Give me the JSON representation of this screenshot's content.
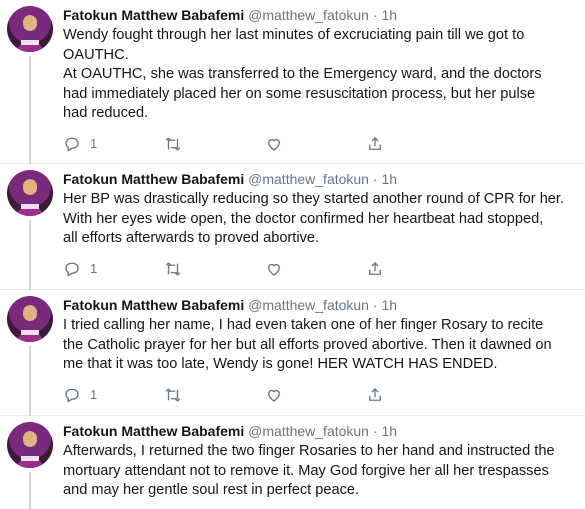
{
  "tweets": [
    {
      "name": "Fatokun Matthew Babafemi",
      "handle": "@matthew_fatokun",
      "separator": "·",
      "time": "1h",
      "lines": [
        "Wendy fought through her last minutes of excruciating pain till we got to",
        "OAUTHC.",
        "At OAUTHC, she was transferred to the Emergency ward, and the doctors",
        "had immediately placed her on some resuscitation process, but her pulse",
        "had reduced."
      ],
      "reply_count": "1"
    },
    {
      "name": "Fatokun Matthew Babafemi",
      "handle": "@matthew_fatokun",
      "separator": "·",
      "time": "1h",
      "lines": [
        "Her BP was drastically reducing so they started another round of CPR for her.",
        "With her eyes wide open, the doctor confirmed her heartbeat had stopped,",
        "all efforts afterwards to proved abortive."
      ],
      "reply_count": "1"
    },
    {
      "name": "Fatokun Matthew Babafemi",
      "handle": "@matthew_fatokun",
      "separator": "·",
      "time": "1h",
      "lines": [
        "I tried calling her name, I had even taken one of her finger Rosary to recite",
        "the Catholic prayer for her but all efforts proved abortive. Then it dawned on",
        "me that it was too late, Wendy is gone! HER WATCH HAS ENDED."
      ],
      "reply_count": "1"
    },
    {
      "name": "Fatokun Matthew Babafemi",
      "handle": "@matthew_fatokun",
      "separator": "·",
      "time": "1h",
      "lines": [
        "Afterwards, I returned the two finger Rosaries to her hand and instructed the",
        "mortuary attendant not to remove it. May God forgive her all her trespasses",
        "and may her gentle soul rest in perfect peace."
      ],
      "reply_count": ""
    }
  ],
  "icons": [
    "reply-icon",
    "retweet-icon",
    "like-icon",
    "share-icon"
  ],
  "colors": {
    "text": "#14171a",
    "muted": "#657786",
    "border": "#e6ecf0"
  }
}
